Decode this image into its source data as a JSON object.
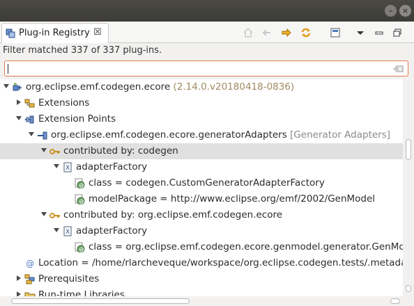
{
  "tab": {
    "label": "Plug-in Registry",
    "close": "☒"
  },
  "window_controls": {
    "minimize": "–",
    "close": "×"
  },
  "filter_text": "Filter matched 337 of 337 plug-ins.",
  "search": {
    "value": "",
    "placeholder": ""
  },
  "tree": [
    {
      "level": 0,
      "expanded": true,
      "icon": "plugin-icon",
      "label": "org.eclipse.emf.codegen.ecore",
      "extra": "(2.14.0.v20180418-0836)",
      "extra_style": "dim"
    },
    {
      "level": 1,
      "expanded": false,
      "icon": "extensions-icon",
      "label": "Extensions"
    },
    {
      "level": 1,
      "expanded": true,
      "icon": "extension-points-icon",
      "label": "Extension Points"
    },
    {
      "level": 2,
      "expanded": true,
      "icon": "extension-point-icon",
      "label": "org.eclipse.emf.codegen.ecore.generatorAdapters",
      "extra": "[Generator Adapters]",
      "extra_style": "gray"
    },
    {
      "level": 3,
      "expanded": true,
      "icon": "contributor-key-icon",
      "label": "contributed by: codegen",
      "selected": true
    },
    {
      "level": 4,
      "expanded": true,
      "icon": "xml-element-icon",
      "label": "adapterFactory"
    },
    {
      "level": 5,
      "leaf": true,
      "icon": "attribute-icon",
      "label": "class = codegen.CustomGeneratorAdapterFactory"
    },
    {
      "level": 5,
      "leaf": true,
      "icon": "attribute-icon",
      "label": "modelPackage = http://www.eclipse.org/emf/2002/GenModel"
    },
    {
      "level": 3,
      "expanded": true,
      "icon": "contributor-key-icon",
      "label": "contributed by: org.eclipse.emf.codegen.ecore"
    },
    {
      "level": 4,
      "expanded": true,
      "icon": "xml-element-icon",
      "label": "adapterFactory"
    },
    {
      "level": 5,
      "leaf": true,
      "icon": "attribute-icon",
      "label": "class = org.eclipse.emf.codegen.ecore.genmodel.generator.GenModelGen"
    },
    {
      "level": 1,
      "leaf": true,
      "icon": "at-icon",
      "label": "Location = /home/rlarcheveque/workspace/org.eclipse.codegen.tests/.metada"
    },
    {
      "level": 1,
      "expanded": false,
      "icon": "prerequisites-icon",
      "label": "Prerequisites"
    },
    {
      "level": 1,
      "expanded": false,
      "icon": "folder-icon",
      "label": "Run-time Libraries"
    }
  ],
  "toolbar_icons": [
    "home-icon",
    "back-icon",
    "forward-icon",
    "refresh-icon",
    "collapse-all-icon",
    "view-menu-icon",
    "minimize-view-icon",
    "maximize-view-icon"
  ],
  "colors": {
    "accent": "#e07a4e",
    "selection": "#e0e0e0",
    "version": "#9e8a60"
  }
}
